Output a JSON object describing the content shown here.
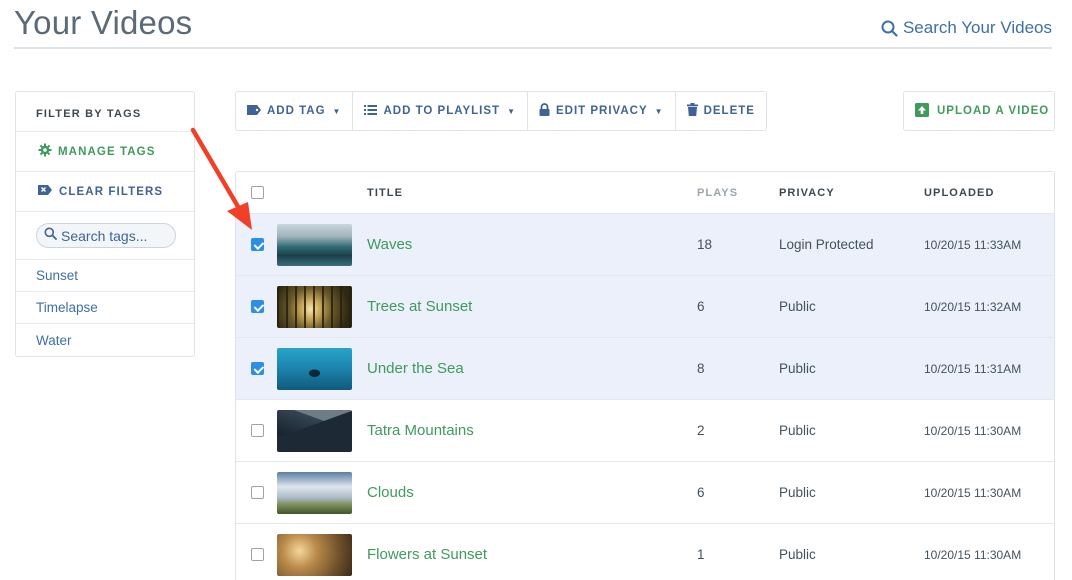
{
  "header": {
    "title": "Your Videos",
    "search_label": "Search Your Videos"
  },
  "sidebar": {
    "heading": "FILTER BY TAGS",
    "manage_label": "MANAGE TAGS",
    "clear_label": "CLEAR FILTERS",
    "search_placeholder": "Search tags...",
    "tags": [
      "Sunset",
      "Timelapse",
      "Water"
    ]
  },
  "toolbar": {
    "add_tag": "ADD TAG",
    "add_to_playlist": "ADD TO PLAYLIST",
    "edit_privacy": "EDIT PRIVACY",
    "delete": "DELETE",
    "upload": "UPLOAD A VIDEO"
  },
  "table": {
    "columns": {
      "title": "TITLE",
      "plays": "PLAYS",
      "privacy": "PRIVACY",
      "uploaded": "UPLOADED"
    },
    "rows": [
      {
        "title": "Waves",
        "plays": "18",
        "privacy": "Login Protected",
        "uploaded": "10/20/15 11:33AM",
        "selected": true,
        "thumb": "waves"
      },
      {
        "title": "Trees at Sunset",
        "plays": "6",
        "privacy": "Public",
        "uploaded": "10/20/15 11:32AM",
        "selected": true,
        "thumb": "trees"
      },
      {
        "title": "Under the Sea",
        "plays": "8",
        "privacy": "Public",
        "uploaded": "10/20/15 11:31AM",
        "selected": true,
        "thumb": "sea"
      },
      {
        "title": "Tatra Mountains",
        "plays": "2",
        "privacy": "Public",
        "uploaded": "10/20/15 11:30AM",
        "selected": false,
        "thumb": "mount"
      },
      {
        "title": "Clouds",
        "plays": "6",
        "privacy": "Public",
        "uploaded": "10/20/15 11:30AM",
        "selected": false,
        "thumb": "clouds"
      },
      {
        "title": "Flowers at Sunset",
        "plays": "1",
        "privacy": "Public",
        "uploaded": "10/20/15 11:30AM",
        "selected": false,
        "thumb": "flowers"
      }
    ]
  },
  "colors": {
    "green_accent": "#3f9a5c",
    "blue_accent": "#3f6395",
    "selected_row": "#ebf0fb",
    "checkbox_checked": "#2d8ee6",
    "annotation_arrow": "#f0402a"
  },
  "icons": {
    "search": "search-icon",
    "gear": "gear-icon",
    "clear_tag": "tag-x-icon",
    "tag": "tag-icon",
    "list": "list-icon",
    "lock": "lock-icon",
    "trash": "trash-icon",
    "upload": "upload-arrow-icon"
  }
}
